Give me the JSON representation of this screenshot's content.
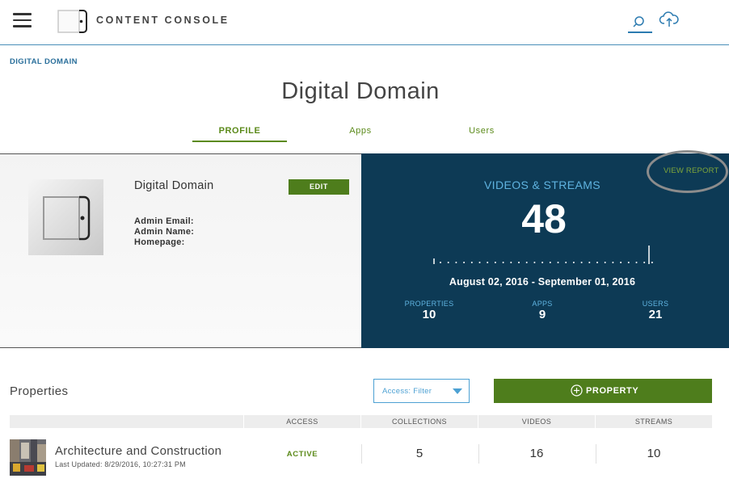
{
  "header": {
    "app_title": "CONTENT CONSOLE",
    "icons": {
      "menu": "hamburger-icon",
      "logo": "brand-logo",
      "search": "search-icon",
      "upload": "cloud-upload-icon"
    }
  },
  "breadcrumb": "DIGITAL DOMAIN",
  "page_title": "Digital Domain",
  "tabs": [
    {
      "label": "PROFILE",
      "active": true
    },
    {
      "label": "Apps",
      "active": false
    },
    {
      "label": "Users",
      "active": false
    }
  ],
  "profile": {
    "name": "Digital Domain",
    "edit_label": "EDIT",
    "admin_email_label": "Admin Email:",
    "admin_name_label": "Admin Name:",
    "homepage_label": "Homepage:"
  },
  "stats": {
    "view_report_label": "VIEW REPORT",
    "title": "VIDEOS & STREAMS",
    "count": "48",
    "date_range": "August 02, 2016 - September 01, 2016",
    "items": [
      {
        "label": "PROPERTIES",
        "value": "10"
      },
      {
        "label": "APPS",
        "value": "9"
      },
      {
        "label": "USERS",
        "value": "21"
      }
    ]
  },
  "properties": {
    "title": "Properties",
    "filter_label": "Access: Filter",
    "add_label": "PROPERTY",
    "columns": [
      "",
      "ACCESS",
      "COLLECTIONS",
      "VIDEOS",
      "STREAMS"
    ],
    "rows": [
      {
        "name": "Architecture and Construction",
        "last_updated": "Last Updated: 8/29/2016, 10:27:31 PM",
        "access": "ACTIVE",
        "collections": "5",
        "videos": "16",
        "streams": "10"
      }
    ]
  },
  "colors": {
    "accent_green": "#4e7d1c",
    "stats_bg": "#0d3a55",
    "link_blue": "#2a6f9b",
    "stat_label_blue": "#5fb3e0"
  }
}
